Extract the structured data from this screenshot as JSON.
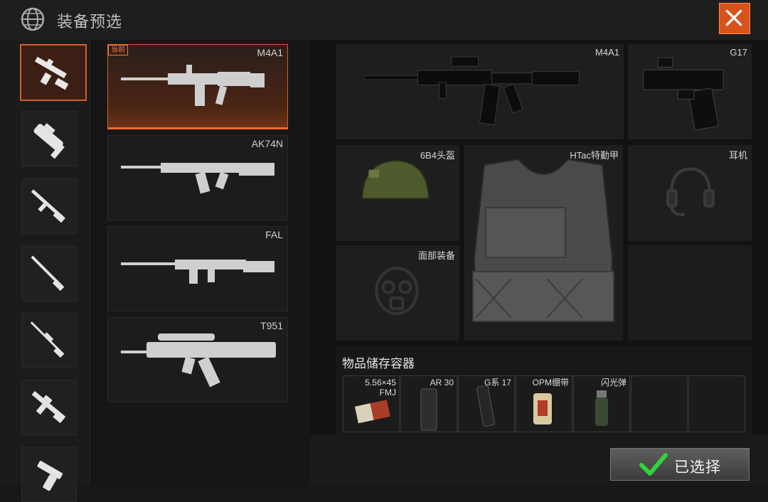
{
  "header": {
    "title": "装备预选",
    "logo_icon": "globe-icon",
    "close_icon": "close-icon"
  },
  "categories": [
    {
      "icon": "assault-rifle-icon",
      "selected": true
    },
    {
      "icon": "smg-icon",
      "selected": false
    },
    {
      "icon": "rifle-icon",
      "selected": false
    },
    {
      "icon": "shotgun-icon",
      "selected": false
    },
    {
      "icon": "sniper-rifle-icon",
      "selected": false
    },
    {
      "icon": "lmg-icon",
      "selected": false
    },
    {
      "icon": "pistol-icon",
      "selected": false
    }
  ],
  "weapons": [
    {
      "name": "M4A1",
      "tag": "当前",
      "selected": true
    },
    {
      "name": "AK74N",
      "selected": false
    },
    {
      "name": "FAL",
      "selected": false
    },
    {
      "name": "T951",
      "selected": false
    }
  ],
  "loadout": {
    "primary": "M4A1",
    "secondary": "G17",
    "helmet": "6B4头盔",
    "armor": "HTac特勤甲",
    "headset": "耳机",
    "face": "面部装备"
  },
  "storage": {
    "title": "物品储存容器",
    "items": [
      "5.56×45 FMJ",
      "AR 30",
      "G系 17",
      "OPM绷带",
      "闪光弹",
      "",
      ""
    ]
  },
  "footer": {
    "confirm_label": "已选择",
    "confirm_icon": "checkmark-icon"
  },
  "colors": {
    "accent": "#d8531c",
    "selected_border": "#d2602d",
    "check": "#2fd33a"
  }
}
